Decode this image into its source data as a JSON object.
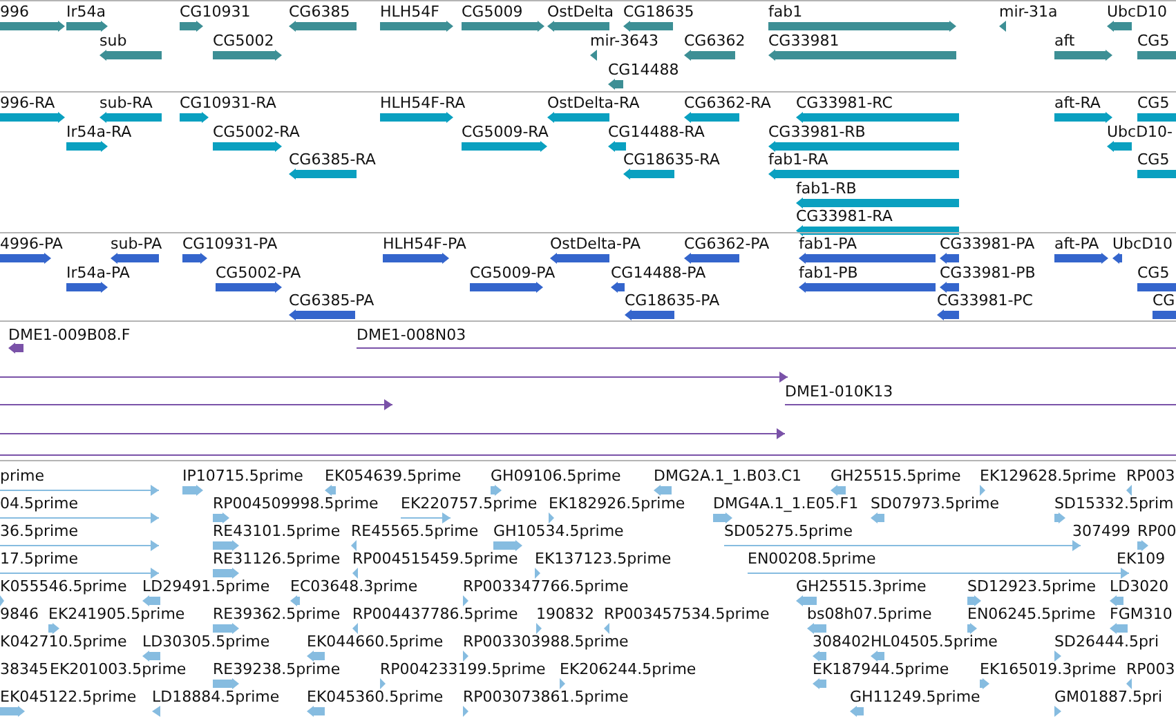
{
  "tracks": [
    {
      "kind": "gene",
      "features": [
        {
          "label": "996",
          "reverse": false
        },
        {
          "label": "Ir54a",
          "reverse": false
        },
        {
          "label": "sub",
          "reverse": true
        },
        {
          "label": "CG10931",
          "reverse": false
        },
        {
          "label": "CG5002",
          "reverse": false
        },
        {
          "label": "CG6385",
          "reverse": true
        },
        {
          "label": "HLH54F",
          "reverse": false
        },
        {
          "label": "CG5009",
          "reverse": false
        },
        {
          "label": "OstDelta",
          "reverse": true
        },
        {
          "label": "CG18635",
          "reverse": true
        },
        {
          "label": "mir-3643",
          "reverse": true
        },
        {
          "label": "CG6362",
          "reverse": true
        },
        {
          "label": "CG14488",
          "reverse": true
        },
        {
          "label": "fab1",
          "reverse": false
        },
        {
          "label": "CG33981",
          "reverse": true
        },
        {
          "label": "mir-31a",
          "reverse": true
        },
        {
          "label": "UbcD10",
          "reverse": true
        },
        {
          "label": "aft",
          "reverse": false
        },
        {
          "label": "CG5",
          "reverse": false
        }
      ]
    },
    {
      "kind": "transcript",
      "features": [
        {
          "label": "996-RA",
          "reverse": false
        },
        {
          "label": "sub-RA",
          "reverse": true
        },
        {
          "label": "Ir54a-RA",
          "reverse": false
        },
        {
          "label": "CG10931-RA",
          "reverse": false
        },
        {
          "label": "CG5002-RA",
          "reverse": false
        },
        {
          "label": "CG6385-RA",
          "reverse": true
        },
        {
          "label": "HLH54F-RA",
          "reverse": false
        },
        {
          "label": "CG5009-RA",
          "reverse": false
        },
        {
          "label": "OstDelta-RA",
          "reverse": true
        },
        {
          "label": "CG6362-RA",
          "reverse": true
        },
        {
          "label": "CG14488-RA",
          "reverse": true
        },
        {
          "label": "CG18635-RA",
          "reverse": true
        },
        {
          "label": "CG33981-RC",
          "reverse": true
        },
        {
          "label": "CG33981-RB",
          "reverse": true
        },
        {
          "label": "fab1-RA",
          "reverse": true
        },
        {
          "label": "fab1-RB",
          "reverse": true
        },
        {
          "label": "CG33981-RA",
          "reverse": true
        },
        {
          "label": "aft-RA",
          "reverse": false
        },
        {
          "label": "CG5",
          "reverse": false
        },
        {
          "label": "UbcD10-",
          "reverse": true
        },
        {
          "label": "CG5",
          "reverse": false
        }
      ]
    },
    {
      "kind": "protein",
      "features": [
        {
          "label": "4996-PA",
          "reverse": false
        },
        {
          "label": "sub-PA",
          "reverse": true
        },
        {
          "label": "Ir54a-PA",
          "reverse": false
        },
        {
          "label": "CG10931-PA",
          "reverse": false
        },
        {
          "label": "CG5002-PA",
          "reverse": false
        },
        {
          "label": "CG6385-PA",
          "reverse": true
        },
        {
          "label": "HLH54F-PA",
          "reverse": false
        },
        {
          "label": "CG5009-PA",
          "reverse": false
        },
        {
          "label": "OstDelta-PA",
          "reverse": true
        },
        {
          "label": "CG6362-PA",
          "reverse": true
        },
        {
          "label": "CG14488-PA",
          "reverse": true
        },
        {
          "label": "CG18635-PA",
          "reverse": true
        },
        {
          "label": "fab1-PA",
          "reverse": true
        },
        {
          "label": "fab1-PB",
          "reverse": true
        },
        {
          "label": "CG33981-PA",
          "reverse": true
        },
        {
          "label": "CG33981-PB",
          "reverse": true
        },
        {
          "label": "CG33981-PC",
          "reverse": true
        },
        {
          "label": "aft-PA",
          "reverse": false
        },
        {
          "label": "UbcD10",
          "reverse": true
        },
        {
          "label": "CG5",
          "reverse": false
        },
        {
          "label": "CG",
          "reverse": false
        }
      ]
    },
    {
      "kind": "clone",
      "features": [
        {
          "label": "DME1-009B08.F",
          "reverse": true
        },
        {
          "label": "DME1-008N03",
          "reverse": false
        },
        {
          "reverse": false
        },
        {
          "label": "DME1-010K13",
          "reverse": false
        },
        {
          "reverse": false
        },
        {
          "reverse": false
        }
      ]
    },
    {
      "kind": "est",
      "features": [
        {
          "label": "prime",
          "reverse": false
        },
        {
          "label": "IP10715.5prime",
          "reverse": false
        },
        {
          "label": "EK054639.5prime",
          "reverse": true
        },
        {
          "label": "GH09106.5prime",
          "reverse": false
        },
        {
          "label": "DMG2A.1_1.B03.C1",
          "reverse": true
        },
        {
          "label": "GH25515.5prime",
          "reverse": true
        },
        {
          "label": "EK129628.5prime",
          "reverse": false
        },
        {
          "label": "RP003",
          "reverse": true
        },
        {
          "label": "04.5prime",
          "reverse": false
        },
        {
          "label": "RP004509998.5prime",
          "reverse": false
        },
        {
          "label": "EK220757.5prime",
          "reverse": false
        },
        {
          "label": "EK182926.5prime",
          "reverse": false
        },
        {
          "label": "DMG4A.1_1.E05.F1",
          "reverse": false
        },
        {
          "label": "SD07973.5prime",
          "reverse": true
        },
        {
          "label": "SD15332.5prim",
          "reverse": false
        },
        {
          "label": "36.5prime",
          "reverse": false
        },
        {
          "label": "RE43101.5prime",
          "reverse": false
        },
        {
          "label": "RE45565.5prime",
          "reverse": true
        },
        {
          "label": "GH10534.5prime",
          "reverse": false
        },
        {
          "label": "SD05275.5prime",
          "reverse": false
        },
        {
          "label": "307499"
        },
        {
          "label": "RP00",
          "reverse": false
        },
        {
          "label": "17.5prime",
          "reverse": false
        },
        {
          "label": "RE31126.5prime",
          "reverse": false
        },
        {
          "label": "RP004515459.5prime",
          "reverse": true
        },
        {
          "label": "EK137123.5prime",
          "reverse": false
        },
        {
          "label": "EN00208.5prime",
          "reverse": false
        },
        {
          "label": "EK109"
        },
        {
          "label": "K055546.5prime",
          "reverse": false
        },
        {
          "label": "LD29491.5prime",
          "reverse": true
        },
        {
          "label": "EC03648.3prime",
          "reverse": true
        },
        {
          "label": "RP003347766.5prime",
          "reverse": false
        },
        {
          "label": "GH25515.3prime",
          "reverse": true
        },
        {
          "label": "SD12923.5prime",
          "reverse": false
        },
        {
          "label": "LD3020",
          "reverse": true
        },
        {
          "label": "9846"
        },
        {
          "label": "EK241905.5prime",
          "reverse": false
        },
        {
          "label": "RE39362.5prime",
          "reverse": false
        },
        {
          "label": "RP004437786.5prime",
          "reverse": true
        },
        {
          "label": "190832",
          "reverse": false
        },
        {
          "label": "RP003457534.5prime",
          "reverse": true
        },
        {
          "label": "bs08h07.5prime",
          "reverse": true
        },
        {
          "label": "EN06245.5prime",
          "reverse": false
        },
        {
          "label": "FGM310",
          "reverse": true
        },
        {
          "label": "K042710.5prime"
        },
        {
          "label": "LD30305.5prime",
          "reverse": true
        },
        {
          "label": "EK044660.5prime",
          "reverse": true
        },
        {
          "label": "RP003303988.5prime",
          "reverse": false
        },
        {
          "label": "308402",
          "reverse": true
        },
        {
          "label": "HL04505.5prime",
          "reverse": true
        },
        {
          "label": "SD26444.5pri",
          "reverse": false
        },
        {
          "label": "38345"
        },
        {
          "label": "EK201003.5prime"
        },
        {
          "label": "RE39238.5prime",
          "reverse": false
        },
        {
          "label": "RP004233199.5prime",
          "reverse": false
        },
        {
          "label": "EK206244.5prime",
          "reverse": false
        },
        {
          "label": "EK187944.5prime",
          "reverse": true
        },
        {
          "label": "EK165019.3prime",
          "reverse": false
        },
        {
          "label": "RP003",
          "reverse": true
        },
        {
          "label": "EK045122.5prime",
          "reverse": false
        },
        {
          "label": "LD18884.5prime",
          "reverse": true
        },
        {
          "label": "EK045360.5prime",
          "reverse": true
        },
        {
          "label": "RP003073861.5prime",
          "reverse": false
        },
        {
          "label": "GH11249.5prime",
          "reverse": true
        },
        {
          "label": "GM01887.5pri",
          "reverse": false
        }
      ]
    }
  ]
}
